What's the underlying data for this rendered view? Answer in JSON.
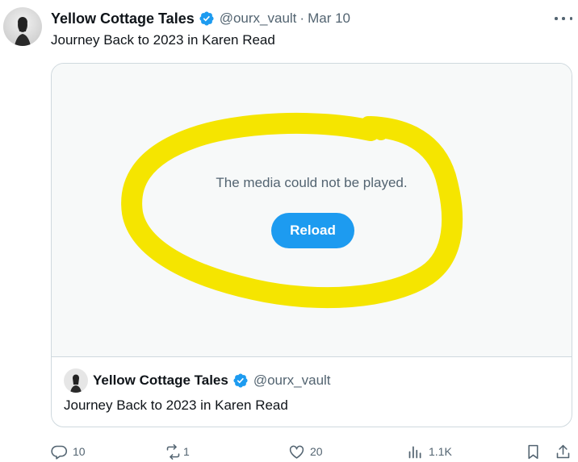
{
  "tweet": {
    "author_name": "Yellow Cottage Tales",
    "handle": "@ourx_vault",
    "separator": "·",
    "date": "Mar 10",
    "text": "Journey Back to 2023 in Karen Read"
  },
  "media": {
    "message": "The media could not be played.",
    "reload_label": "Reload",
    "reload_color": "#1d9bf0",
    "highlight_color": "#f5e500"
  },
  "quote": {
    "author_name": "Yellow Cottage Tales",
    "handle": "@ourx_vault",
    "text": "Journey Back to 2023 in Karen Read"
  },
  "actions": {
    "replies": "10",
    "reposts": "1",
    "likes": "20",
    "views": "1.1K",
    "icons": [
      "reply-icon",
      "repost-icon",
      "like-icon",
      "views-icon",
      "bookmark-icon",
      "share-icon"
    ]
  },
  "colors": {
    "verified": "#1d9bf0",
    "secondary_text": "#536471",
    "primary_text": "#0f1419",
    "border": "#cfd9de"
  }
}
